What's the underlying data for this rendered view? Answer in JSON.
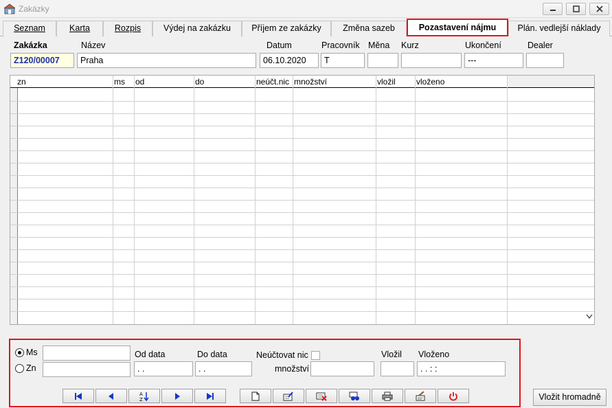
{
  "window": {
    "title": "Zakázky"
  },
  "tabs": [
    {
      "label": "Seznam",
      "active": false
    },
    {
      "label": "Karta",
      "active": false
    },
    {
      "label": "Rozpis",
      "active": false
    },
    {
      "label": "Výdej na zakázku",
      "active": false
    },
    {
      "label": "Příjem ze zakázky",
      "active": false
    },
    {
      "label": "Změna sazeb",
      "active": false
    },
    {
      "label": "Pozastavení nájmu",
      "active": true
    },
    {
      "label": "Plán. vedlejší náklady",
      "active": false
    }
  ],
  "header": {
    "zakazka_label": "Zakázka",
    "zakazka_value": "Z120/00007",
    "nazev_label": "Název",
    "nazev_value": "Praha",
    "datum_label": "Datum",
    "datum_value": "06.10.2020",
    "pracovnik_label": "Pracovník",
    "pracovnik_value": "T",
    "mena_label": "Měna",
    "mena_value": "",
    "kurz_label": "Kurz",
    "kurz_value": "",
    "ukonceni_label": "Ukončení",
    "ukonceni_value": "---",
    "dealer_label": "Dealer",
    "dealer_value": ""
  },
  "grid": {
    "columns": [
      "zn",
      "ms",
      "od",
      "do",
      "neúčt.nic",
      "množství",
      "vložil",
      "vloženo"
    ],
    "rows": []
  },
  "filter": {
    "radio_ms": "Ms",
    "radio_zn": "Zn",
    "radio_selected": "Ms",
    "ms_value": "",
    "zn_value": "",
    "od_data_label": "Od data",
    "od_data_value": " . .",
    "do_data_label": "Do data",
    "do_data_value": " . .",
    "neuctovat_label": "Neúčtovat nic",
    "mnozstvi_label": "množství",
    "mnozstvi_value": "",
    "vlozil_label": "Vložil",
    "vlozil_value": "",
    "vlozeno_label": "Vloženo",
    "vlozeno_value": " . .    : :"
  },
  "toolbar": {
    "buttons": [
      "first-icon",
      "prev-icon",
      "sort-az-icon",
      "next-icon",
      "last-icon",
      "new-document-icon",
      "edit-icon",
      "delete-icon",
      "find-icon",
      "print-icon",
      "settings-icon",
      "power-icon"
    ],
    "bulk_insert_label": "Vložit hromadně"
  },
  "colors": {
    "accent_red": "#e0141b",
    "nav_blue": "#1538c9",
    "code_blue": "#1f2fa8"
  }
}
